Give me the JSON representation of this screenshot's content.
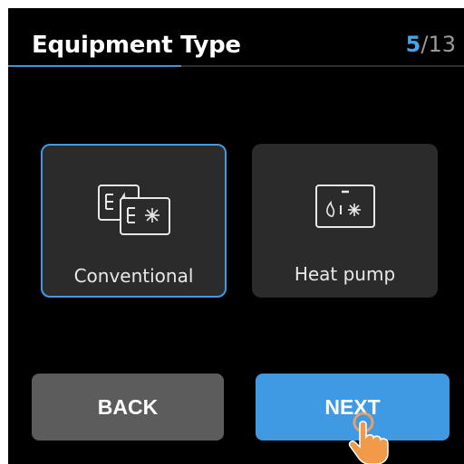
{
  "header": {
    "title": "Equipment Type",
    "step_current": "5",
    "step_total": "/13",
    "progress": 0.38
  },
  "options": [
    {
      "label": "Conventional",
      "icon": "conventional-system-icon",
      "selected": true
    },
    {
      "label": "Heat pump",
      "icon": "heat-pump-icon",
      "selected": false
    }
  ],
  "buttons": {
    "back": "BACK",
    "next": "NEXT"
  },
  "colors": {
    "accent": "#3f9ae3",
    "background": "#000000",
    "card": "#2b2b2b",
    "back_button": "#5c5c5c"
  }
}
